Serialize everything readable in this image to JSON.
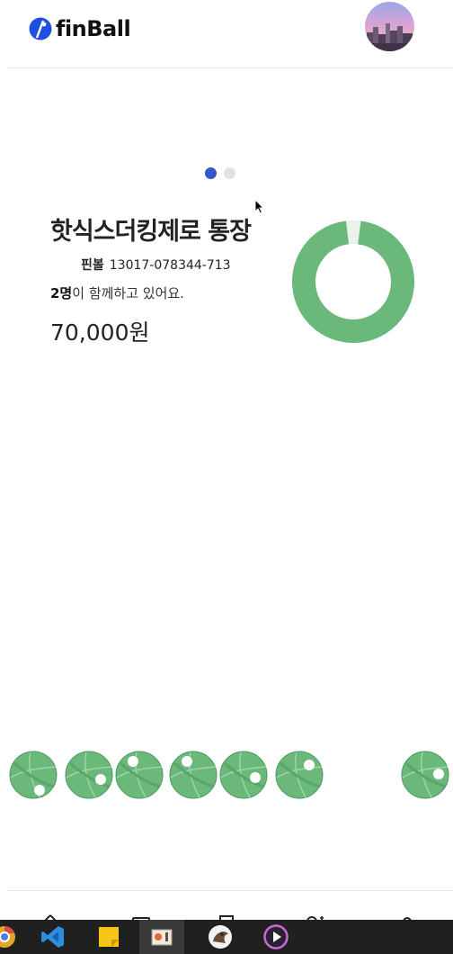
{
  "header": {
    "logo_text": "finBall",
    "logo_icon": "finball-logo-icon",
    "avatar_icon": "profile-avatar"
  },
  "carousel": {
    "page_count": 2,
    "active_index": 0
  },
  "account": {
    "name": "핫식스더킹제로 통장",
    "bank": "핀볼",
    "number": "13017-078344-713",
    "member_count": "2명",
    "member_suffix": "이 함께하고 있어요.",
    "balance": "70,000원",
    "progress_fraction": 0.98
  },
  "balls": {
    "count": 7,
    "color": "#6ab87a"
  },
  "bottom_nav": {
    "icons": [
      "home-icon",
      "card-icon",
      "document-icon",
      "group-icon",
      "user-icon"
    ]
  },
  "taskbar": {
    "apps": [
      "chrome-icon",
      "vscode-icon",
      "sticky-notes-icon",
      "paint-icon",
      "dbeaver-icon",
      "media-player-icon"
    ]
  },
  "colors": {
    "accent": "#3558c8",
    "donut": "#6ab87a",
    "text": "#222222",
    "taskbar": "#202020"
  }
}
